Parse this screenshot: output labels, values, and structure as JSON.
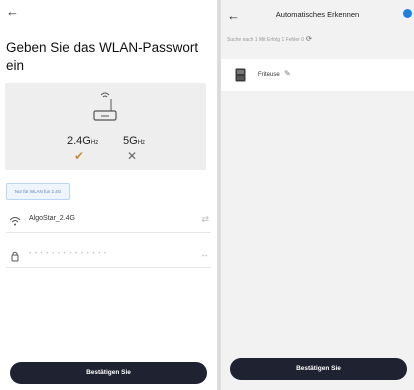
{
  "left": {
    "back_icon": "arrow-left-icon",
    "title": "Geben Sie das WLAN-Passwort ein",
    "bands": [
      {
        "label": "2.4G",
        "unit": "Hz",
        "supported": true
      },
      {
        "label": "5G",
        "unit": "Hz",
        "supported": false
      }
    ],
    "hint": "Nur für WLAN fun 2.4G",
    "ssid": "AlgoStar_2.4G",
    "password_mask": "• • • • • • • • • • • • • •",
    "confirm_label": "Bestätigen Sie"
  },
  "right": {
    "back_icon": "arrow-left-icon",
    "title": "Automatisches Erkennen",
    "status": "Suche nach 1  Mit Erfolg 1  Fehler 0",
    "device_name": "Friteuse",
    "confirm_label": "Bestätigen Sie"
  },
  "colors": {
    "accent_button": "#1f2230",
    "check": "#c98b3c",
    "info": "#1f7fe0"
  }
}
